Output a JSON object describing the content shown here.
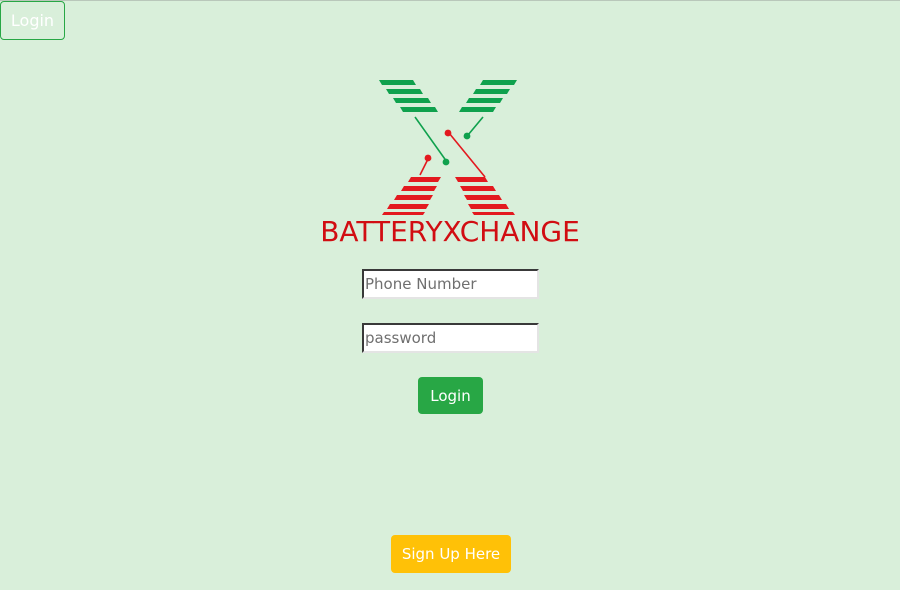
{
  "nav": {
    "login_label": "Login"
  },
  "brand": {
    "name": "BATTERYXCHANGE",
    "color": "#d10d12",
    "logo_icon": "battery-x-logo",
    "logo_colors": {
      "green": "#0fa14d",
      "red": "#e3191f"
    }
  },
  "form": {
    "phone_placeholder": "Phone Number",
    "phone_value": "",
    "password_placeholder": "password",
    "password_value": "",
    "login_label": "Login",
    "login_color": "#28a745"
  },
  "signup": {
    "label": "Sign Up Here",
    "color": "#ffc107"
  },
  "background_color": "#d9efda"
}
